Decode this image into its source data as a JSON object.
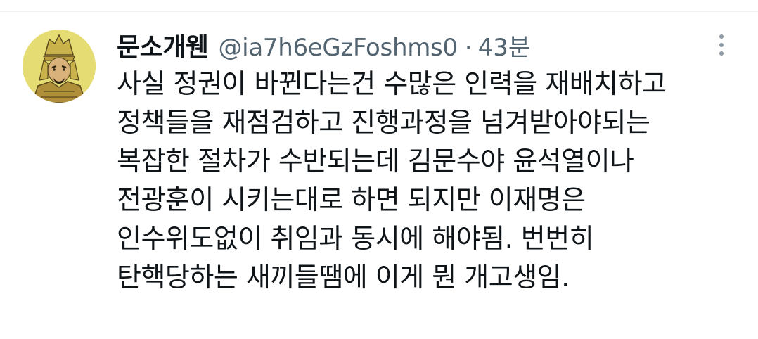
{
  "tweet": {
    "author": {
      "display_name": "문소개웬",
      "handle": "@ia7h6eGzFoshms0",
      "avatar_icon": "warrior-portrait-avatar"
    },
    "separator": "·",
    "time": "43분",
    "text": "사실 정권이 바뀐다는건 수많은 인력을 재배치하고\n정책들을 재점검하고 진행과정을 넘겨받아야되는\n복잡한 절차가 수반되는데 김문수야 윤석열이나\n전광훈이 시키는대로 하면 되지만 이재명은\n인수위도없이 취임과 동시에 해야됨. 번번히\n탄핵당하는 새끼들땜에 이게 뭔 개고생임.",
    "more_icon": "more-options-icon"
  },
  "colors": {
    "text_primary": "#0f1419",
    "text_secondary": "#536471",
    "avatar_background": "#e6dc74"
  }
}
